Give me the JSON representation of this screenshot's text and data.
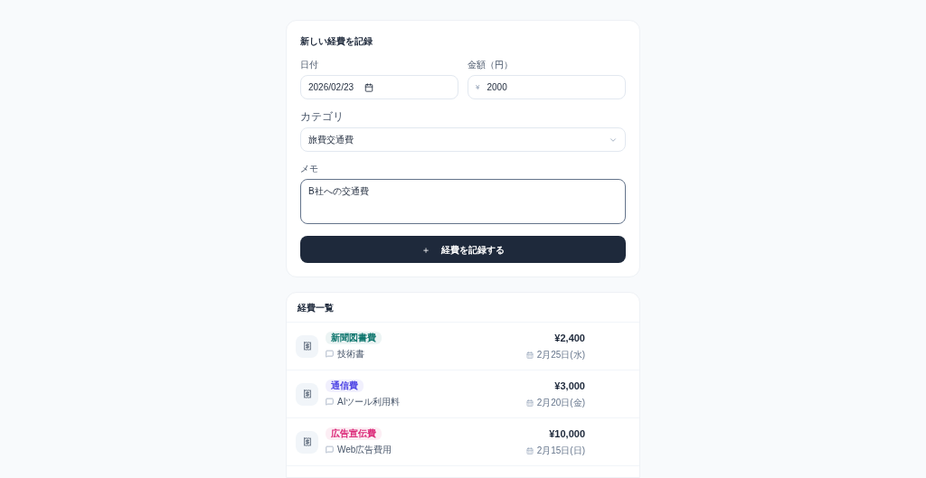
{
  "form": {
    "title": "新しい経費を記録",
    "date": {
      "label": "日付",
      "value": "2026/02/23"
    },
    "amount": {
      "label": "金額（円）",
      "prefix": "¥",
      "value": "2000"
    },
    "category": {
      "label": "カテゴリ",
      "value": "旅費交通費"
    },
    "memo": {
      "label": "メモ",
      "value": "B社への交通費"
    },
    "submit": {
      "icon": "＋",
      "label": "経費を記録する"
    }
  },
  "list": {
    "title": "経費一覧",
    "items": [
      {
        "category": "新聞図書費",
        "color": "#0f766e",
        "memo": "技術書",
        "amount": "¥2,400",
        "date": "2月25日(水)"
      },
      {
        "category": "通信費",
        "color": "#4f46e5",
        "memo": "AIツール利用料",
        "amount": "¥3,000",
        "date": "2月20日(金)"
      },
      {
        "category": "広告宣伝費",
        "color": "#db2777",
        "memo": "Web広告費用",
        "amount": "¥10,000",
        "date": "2月15日(日)"
      }
    ]
  }
}
